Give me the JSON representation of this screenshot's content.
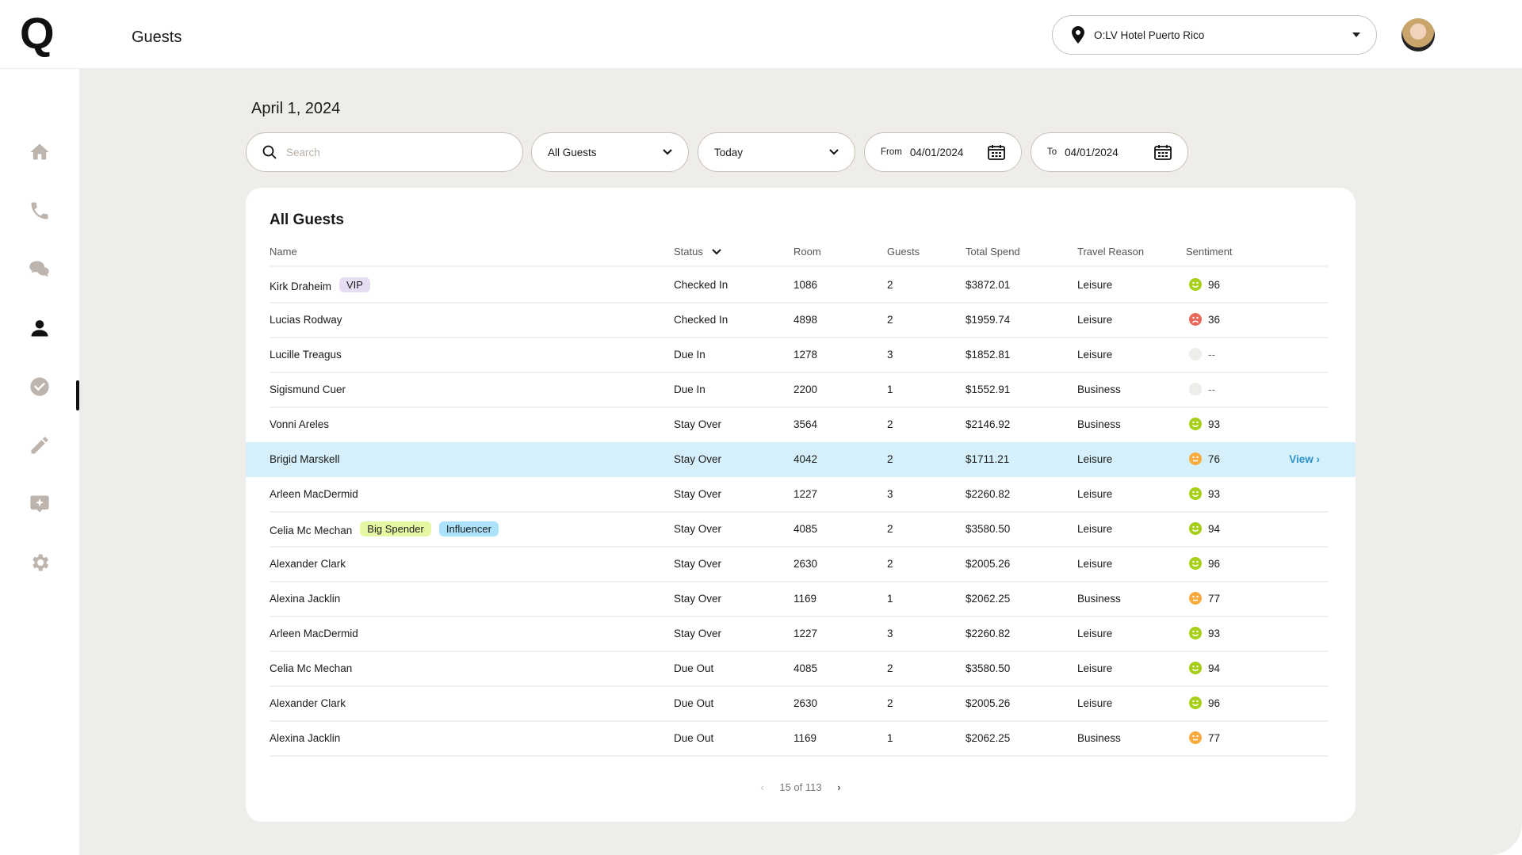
{
  "header": {
    "logo": "Q",
    "title": "Guests",
    "location": "O:LV Hotel Puerto Rico"
  },
  "sidebar": {
    "items": [
      "home",
      "phone",
      "chat",
      "guests",
      "tasks",
      "edit",
      "ai-chat",
      "settings"
    ],
    "active": "guests"
  },
  "date": "April 1, 2024",
  "filters": {
    "search_placeholder": "Search",
    "guest_type": "All Guests",
    "period": "Today",
    "from_label": "From",
    "from_value": "04/01/2024",
    "to_label": "To",
    "to_value": "04/01/2024"
  },
  "table": {
    "title": "All Guests",
    "columns": [
      "Name",
      "Status",
      "Room",
      "Guests",
      "Total Spend",
      "Travel Reason",
      "Sentiment"
    ],
    "view_label": "View",
    "rows": [
      {
        "name": "Kirk Draheim",
        "tags": [
          "VIP"
        ],
        "status": "Checked In",
        "room": "1086",
        "guests": "2",
        "spend": "$3872.01",
        "reason": "Leisure",
        "sentiment": "96",
        "mood": "happy"
      },
      {
        "name": "Lucias Rodway",
        "tags": [],
        "status": "Checked In",
        "room": "4898",
        "guests": "2",
        "spend": "$1959.74",
        "reason": "Leisure",
        "sentiment": "36",
        "mood": "sad"
      },
      {
        "name": "Lucille Treagus",
        "tags": [],
        "status": "Due In",
        "room": "1278",
        "guests": "3",
        "spend": "$1852.81",
        "reason": "Leisure",
        "sentiment": "--",
        "mood": "none"
      },
      {
        "name": "Sigismund Cuer",
        "tags": [],
        "status": "Due In",
        "room": "2200",
        "guests": "1",
        "spend": "$1552.91",
        "reason": "Business",
        "sentiment": "--",
        "mood": "none"
      },
      {
        "name": "Vonni Areles",
        "tags": [],
        "status": "Stay Over",
        "room": "3564",
        "guests": "2",
        "spend": "$2146.92",
        "reason": "Business",
        "sentiment": "93",
        "mood": "happy"
      },
      {
        "name": "Brigid Marskell",
        "tags": [],
        "status": "Stay Over",
        "room": "4042",
        "guests": "2",
        "spend": "$1711.21",
        "reason": "Leisure",
        "sentiment": "76",
        "mood": "neutral",
        "highlighted": true
      },
      {
        "name": "Arleen MacDermid",
        "tags": [],
        "status": "Stay Over",
        "room": "1227",
        "guests": "3",
        "spend": "$2260.82",
        "reason": "Leisure",
        "sentiment": "93",
        "mood": "happy"
      },
      {
        "name": "Celia Mc Mechan",
        "tags": [
          "Big Spender",
          "Influencer"
        ],
        "status": "Stay Over",
        "room": "4085",
        "guests": "2",
        "spend": "$3580.50",
        "reason": "Leisure",
        "sentiment": "94",
        "mood": "happy"
      },
      {
        "name": "Alexander Clark",
        "tags": [],
        "status": "Stay Over",
        "room": "2630",
        "guests": "2",
        "spend": "$2005.26",
        "reason": "Leisure",
        "sentiment": "96",
        "mood": "happy"
      },
      {
        "name": "Alexina Jacklin",
        "tags": [],
        "status": "Stay Over",
        "room": "1169",
        "guests": "1",
        "spend": "$2062.25",
        "reason": "Business",
        "sentiment": "77",
        "mood": "neutral"
      },
      {
        "name": "Arleen MacDermid",
        "tags": [],
        "status": "Stay Over",
        "room": "1227",
        "guests": "3",
        "spend": "$2260.82",
        "reason": "Leisure",
        "sentiment": "93",
        "mood": "happy"
      },
      {
        "name": "Celia Mc Mechan",
        "tags": [],
        "status": "Due Out",
        "room": "4085",
        "guests": "2",
        "spend": "$3580.50",
        "reason": "Leisure",
        "sentiment": "94",
        "mood": "happy"
      },
      {
        "name": "Alexander Clark",
        "tags": [],
        "status": "Due Out",
        "room": "2630",
        "guests": "2",
        "spend": "$2005.26",
        "reason": "Leisure",
        "sentiment": "96",
        "mood": "happy"
      },
      {
        "name": "Alexina Jacklin",
        "tags": [],
        "status": "Due Out",
        "room": "1169",
        "guests": "1",
        "spend": "$2062.25",
        "reason": "Business",
        "sentiment": "77",
        "mood": "neutral"
      }
    ]
  },
  "pagination": {
    "text": "15 of 113"
  },
  "colors": {
    "happy": "#a6cf1a",
    "sad": "#e96a5c",
    "neutral": "#f8ab3c",
    "none": "#efedea",
    "VIP": "#e6ddf3",
    "Big Spender": "#e6f7a3",
    "Influencer": "#ace2fb",
    "highlight": "#d6f0fb",
    "link": "#2b93c9"
  }
}
